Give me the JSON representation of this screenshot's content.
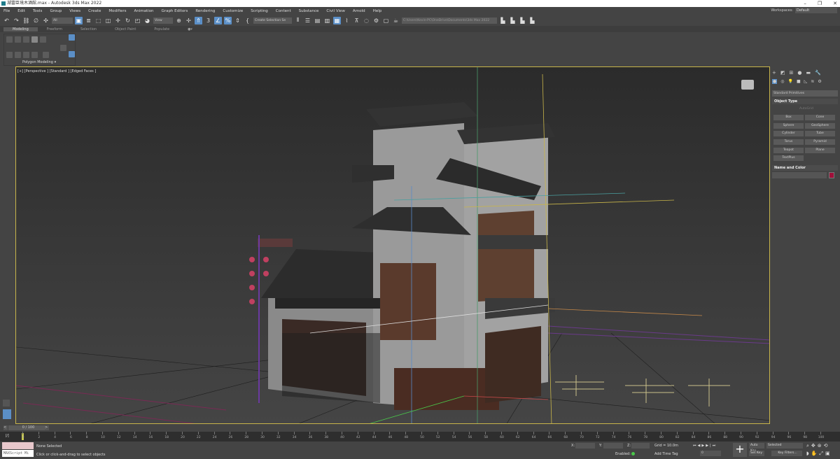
{
  "window": {
    "title": "湖富臣境木酒館.max - Autodesk 3ds Max 2022",
    "minimize": "–",
    "restore": "❐",
    "close": "✕"
  },
  "menu": [
    "File",
    "Edit",
    "Tools",
    "Group",
    "Views",
    "Create",
    "Modifiers",
    "Animation",
    "Graph Editors",
    "Rendering",
    "Customize",
    "Scripting",
    "Content",
    "Substance",
    "Civil View",
    "Arnold",
    "Help"
  ],
  "workspaces": {
    "label": "Workspaces:",
    "value": "Default"
  },
  "toolbar": {
    "selection_filter": "All",
    "ref_coord": "View",
    "named_selection": "Create Selection Se",
    "project_path": "C:\\Users\\Kevin-PC\\OneDrive\\Documents\\3ds Max 2022"
  },
  "ribbon": {
    "tabs": [
      "Modeling",
      "Freeform",
      "Selection",
      "Object Paint",
      "Populate"
    ],
    "active_tab": "Modeling",
    "panel_label": "Polygon Modeling ▾"
  },
  "viewport": {
    "label": "[+] [Perspective ] [Standard ] [Edged Faces ]"
  },
  "command_panel": {
    "category": "Standard Primitives",
    "object_type_title": "Object Type",
    "autogrid": "AutoGrid",
    "buttons": [
      "Box",
      "Cone",
      "Sphere",
      "GeoSphere",
      "Cylinder",
      "Tube",
      "Torus",
      "Pyramid",
      "Teapot",
      "Plane",
      "TextPlus"
    ],
    "name_color_title": "Name and Color",
    "object_color": "#a0103a"
  },
  "timeline": {
    "frame_display": "0 / 100",
    "ticks": [
      "0",
      "2",
      "4",
      "6",
      "8",
      "10",
      "12",
      "14",
      "16",
      "18",
      "20",
      "22",
      "24",
      "26",
      "28",
      "30",
      "32",
      "34",
      "36",
      "38",
      "40",
      "42",
      "44",
      "46",
      "48",
      "50",
      "52",
      "54",
      "56",
      "58",
      "60",
      "62",
      "64",
      "66",
      "68",
      "70",
      "72",
      "74",
      "76",
      "78",
      "80",
      "82",
      "84",
      "86",
      "88",
      "90",
      "92",
      "94",
      "96",
      "98",
      "100"
    ]
  },
  "status": {
    "maxscript": "MAXScript Mi",
    "selection": "None Selected",
    "prompt": "Click or click-and-drag to select objects",
    "x_label": "X:",
    "y_label": "Y:",
    "z_label": "Z:",
    "grid": "Grid = 10.0m",
    "enabled": "Enabled:",
    "add_time_tag": "Add Time Tag",
    "auto_key": "Auto Key",
    "set_key": "Set Key",
    "key_mode": "Selected",
    "key_filters": "Key Filters...",
    "current_frame": "0"
  }
}
